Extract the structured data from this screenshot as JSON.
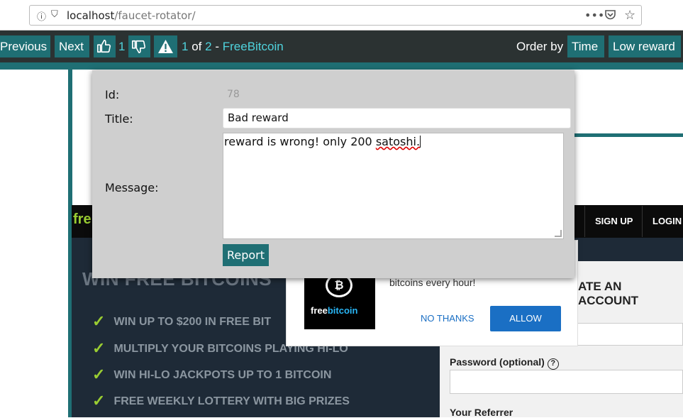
{
  "browser": {
    "url_host": "localhost",
    "url_path": "/faucet-rotator/",
    "more_icon": "more-horizontal-icon",
    "pocket_icon": "pocket-icon",
    "bookmark_icon": "star-icon"
  },
  "toolbar": {
    "previous_label": "Previous",
    "next_label": "Next",
    "like_count": "1",
    "position_current": "1",
    "position_of": "of",
    "position_total": "2",
    "separator": "-",
    "faucet_name": "FreeBitcoin",
    "order_by_label": "Order by",
    "order_time_label": "Time",
    "order_low_reward_label": "Low reward"
  },
  "site": {
    "logo_text": "fre",
    "nav_signup": "SIGN UP",
    "nav_login": "LOGIN",
    "headline": "WIN FREE BITCOINS",
    "features": [
      "WIN UP TO $200 IN FREE BIT",
      "MULTIPLY YOUR BITCOINS PLAYING HI-LO",
      "WIN HI-LO JACKPOTS UP TO 1 BITCOIN",
      "FREE WEEKLY LOTTERY WITH BIG PRIZES"
    ],
    "signup_title": "ATE AN ACCOUNT",
    "password_label": "Password (optional)",
    "referrer_label": "Your Referrer"
  },
  "notification_popup": {
    "brand_free": "free",
    "brand_bitcoin": "bitcoin",
    "coin_glyph": "₿",
    "text": "bitcoins every hour!",
    "no_thanks_label": "NO THANKS",
    "allow_label": "ALLOW"
  },
  "report_modal": {
    "id_label": "Id:",
    "id_value": "78",
    "title_label": "Title:",
    "title_value": "Bad reward",
    "message_label": "Message:",
    "message_before": "reward is wrong! only 200 ",
    "message_misspelled": "satoshi.",
    "submit_label": "Report"
  },
  "colors": {
    "accent_teal": "#1f6f74",
    "toolbar_bg": "#2b3232",
    "highlight_cyan": "#4fd3dd",
    "site_green": "#9acd32",
    "allow_blue": "#1a6fc4"
  }
}
